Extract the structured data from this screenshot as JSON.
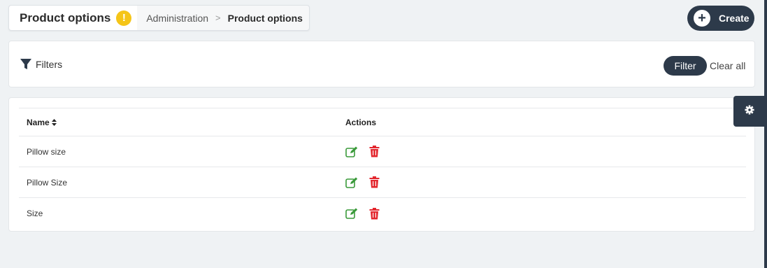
{
  "header": {
    "title": "Product options",
    "warning_symbol": "!",
    "breadcrumb": {
      "parent": "Administration",
      "separator": ">",
      "current": "Product options"
    }
  },
  "create_button": {
    "label": "Create",
    "icon": "plus-circle-icon"
  },
  "filters": {
    "label": "Filters",
    "icon": "filter-icon",
    "filter_button": "Filter",
    "clear_all": "Clear all"
  },
  "settings_tab": {
    "icon": "gear-icon"
  },
  "table": {
    "columns": [
      "Name",
      "Actions"
    ],
    "name_sortable": true,
    "rows": [
      {
        "name": "Pillow size"
      },
      {
        "name": "Pillow Size"
      },
      {
        "name": "Size"
      }
    ],
    "action_icons": [
      "edit-icon",
      "delete-icon"
    ]
  },
  "colors": {
    "primary_dark": "#2d3a4a",
    "warning": "#f5c518",
    "edit_green": "#3a9a3a",
    "delete_red": "#e3262d",
    "background": "#eff2f4"
  }
}
